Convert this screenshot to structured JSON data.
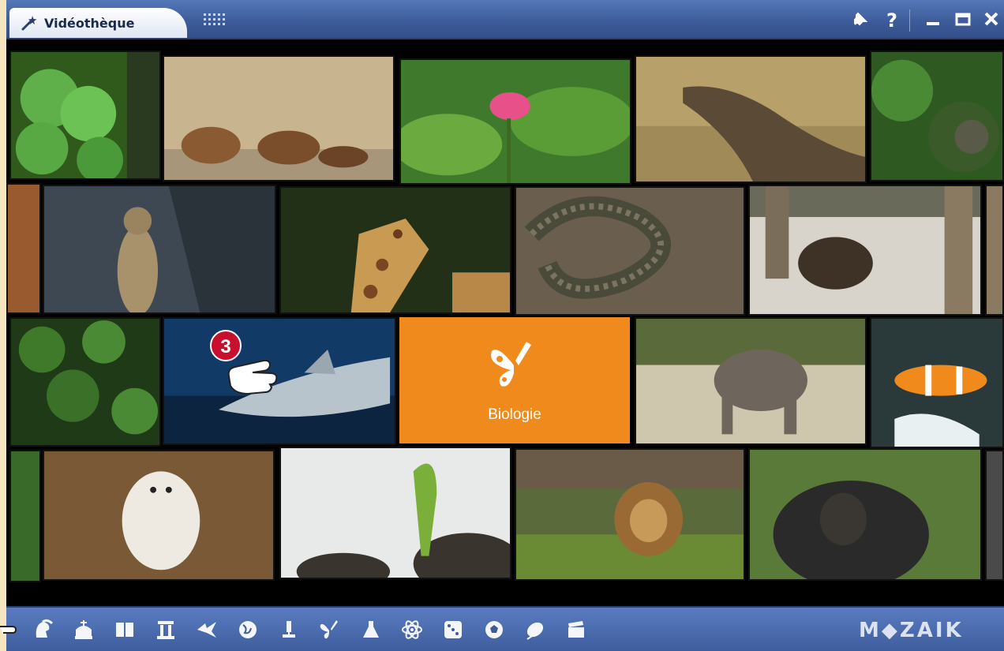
{
  "window": {
    "title": "Vidéothèque"
  },
  "title_icons": [
    "wand-icon",
    "grid-icon",
    "pin-icon",
    "help-icon",
    "minimize-icon",
    "maximize-icon",
    "close-icon"
  ],
  "help_label": "?",
  "featured_tile": {
    "label": "Biologie",
    "icon": "butterfly-icon",
    "color": "#f08a1c"
  },
  "step_badge": "3",
  "tiles": [
    "clover",
    "goats",
    "lotus",
    "komodo-dragon",
    "jungle",
    "meerkat",
    "giraffe",
    "snake",
    "bison",
    "ivy",
    "shark",
    "elephant",
    "clownfish",
    "snowy-owl",
    "sprout",
    "lion",
    "gorilla"
  ],
  "toolbar_icons": [
    "helmet-icon",
    "crown-icon",
    "book-icon",
    "column-icon",
    "bird-icon",
    "globe-icon",
    "microscope-icon",
    "butterfly-icon",
    "flask-icon",
    "atom-icon",
    "dice-icon",
    "ball-icon",
    "mouse-icon",
    "clapperboard-icon"
  ],
  "brand": "M◆ZAIK",
  "colors": {
    "titlebar": "#3c5a98",
    "accent_orange": "#f08a1c",
    "badge_red": "#c8102e"
  }
}
